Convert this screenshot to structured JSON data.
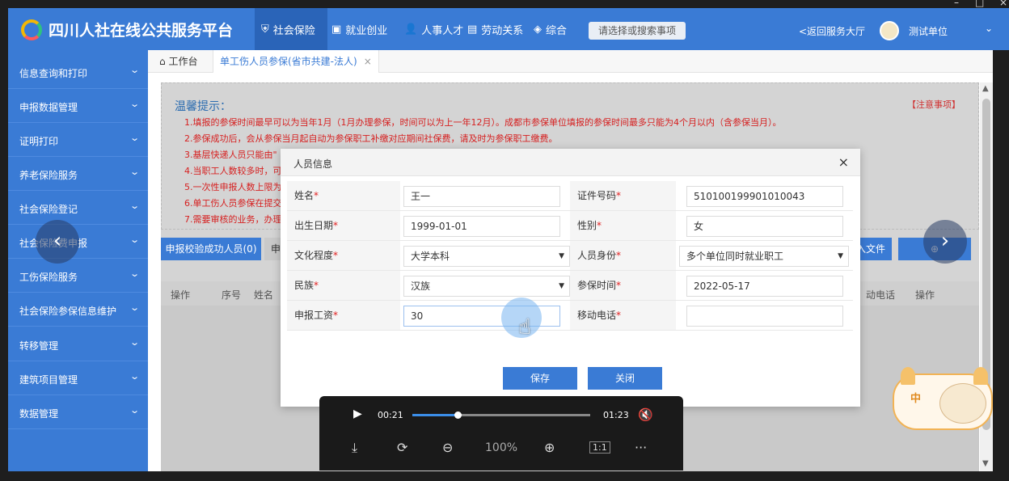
{
  "header": {
    "title": "四川人社在线公共服务平台",
    "nav": [
      {
        "label": "社会保险",
        "icon": "shield-icon",
        "active": true
      },
      {
        "label": "就业创业",
        "icon": "briefcase-icon"
      },
      {
        "label": "人事人才",
        "icon": "person-icon"
      },
      {
        "label": "劳动关系",
        "icon": "document-icon"
      },
      {
        "label": "综合",
        "icon": "layers-icon"
      }
    ],
    "search_placeholder": "请选择或搜索事项",
    "back_label": "<返回服务大厅",
    "username": "测试单位",
    "accent_color": "#3a7bd5"
  },
  "sidebar": {
    "items": [
      {
        "label": "信息查询和打印"
      },
      {
        "label": "申报数据管理"
      },
      {
        "label": "证明打印"
      },
      {
        "label": "养老保险服务"
      },
      {
        "label": "社会保险登记"
      },
      {
        "label": "社会保险费申报"
      },
      {
        "label": "工伤保险服务"
      },
      {
        "label": "社会保险参保信息维护"
      },
      {
        "label": "转移管理"
      },
      {
        "label": "建筑项目管理"
      },
      {
        "label": "数据管理"
      }
    ]
  },
  "tabs": {
    "home_label": "工作台",
    "active_label": "单工伤人员参保(省市共建-法人)",
    "close_glyph": "×"
  },
  "tips": {
    "title": "温馨提示：",
    "note_link": "【注意事项】",
    "lines": [
      "1.填报的参保时间最早可以为当年1月（1月办理参保，时间可以为上一年12月）。成都市参保单位填报的参保时间最多只能为4个月以内（含参保当月）。",
      "2.参保成功后，会从参保当月起自动为参保职工补缴对应期间社保费，请及时为参保职工缴费。",
      "3.基层快递人员只能由\"",
      "4.当职工人数较多时，可",
      "5.一次性申报人数上限为",
      "6.单工伤人员参保在提交",
      "7.需要审核的业务，办理"
    ]
  },
  "toolbar": {
    "success_tab": "申报校验成功人员(0)",
    "other_tab": "申",
    "import_label": "入文件",
    "right_label": "",
    "right_icon": "download-icon"
  },
  "grid": {
    "headers": [
      "操作",
      "序号",
      "姓名",
      "动电话",
      "操作"
    ]
  },
  "dialog": {
    "title": "人员信息",
    "fields": [
      {
        "label": "姓名",
        "value": "王一",
        "dropdown": false
      },
      {
        "label": "证件号码",
        "value": "510100199901010043",
        "dropdown": false
      },
      {
        "label": "出生日期",
        "value": "1999-01-01",
        "dropdown": false
      },
      {
        "label": "性别",
        "value": "女",
        "dropdown": false
      },
      {
        "label": "文化程度",
        "value": "大学本科",
        "dropdown": true
      },
      {
        "label": "人员身份",
        "value": "多个单位同时就业职工",
        "dropdown": true
      },
      {
        "label": "民族",
        "value": "汉族",
        "dropdown": true
      },
      {
        "label": "参保时间",
        "value": "2022-05-17",
        "dropdown": false
      },
      {
        "label": "申报工资",
        "value": "30",
        "dropdown": false
      },
      {
        "label": "移动电话",
        "value": "",
        "dropdown": false
      }
    ],
    "required_mark": "*",
    "save_label": "保存",
    "close_label": "关闭"
  },
  "sticker": {
    "text": "中"
  },
  "player": {
    "current_time": "00:21",
    "total_time": "01:23",
    "progress": 0.253,
    "zoom": "100%",
    "actual_size_label": "1:1",
    "more_glyph": "···"
  }
}
